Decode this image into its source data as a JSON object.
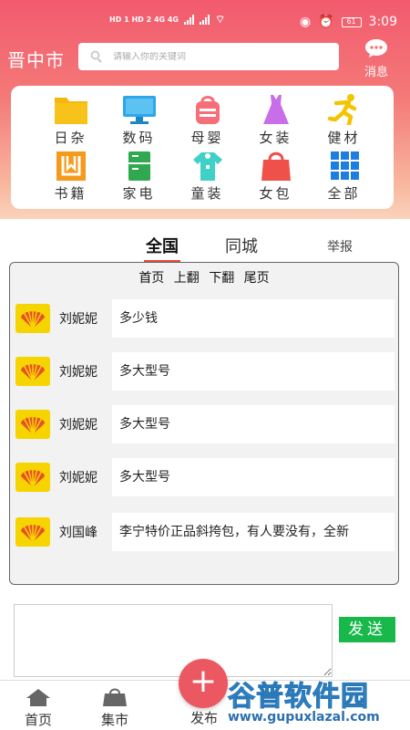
{
  "status": {
    "left": "HD 1 HD 2 4G 4G",
    "battery": "61",
    "time": "3:09"
  },
  "header": {
    "city": "晋中市",
    "search_placeholder": "请输入你的关键词",
    "message_label": "消息"
  },
  "categories": [
    {
      "label": "日杂",
      "icon": "folder-icon",
      "color": "#f7c31a"
    },
    {
      "label": "数码",
      "icon": "monitor-icon",
      "color": "#2ea7e8"
    },
    {
      "label": "母婴",
      "icon": "baby-bag-icon",
      "color": "#f56e78"
    },
    {
      "label": "女装",
      "icon": "dress-icon",
      "color": "#c76ee8"
    },
    {
      "label": "健材",
      "icon": "running-icon",
      "color": "#f5c400"
    },
    {
      "label": "书籍",
      "icon": "book-icon",
      "color": "#f59a1a"
    },
    {
      "label": "家电",
      "icon": "fridge-icon",
      "color": "#2fa84f"
    },
    {
      "label": "童装",
      "icon": "baby-clothes-icon",
      "color": "#3fd0c8"
    },
    {
      "label": "女包",
      "icon": "handbag-icon",
      "color": "#f0504a"
    },
    {
      "label": "全部",
      "icon": "grid-icon",
      "color": "#1e7de0"
    }
  ],
  "tabs": {
    "national": "全国",
    "local": "同城",
    "report": "举报"
  },
  "pager": {
    "first": "首页",
    "prev": "上翻",
    "next": "下翻",
    "last": "尾页"
  },
  "posts": [
    {
      "user": "刘妮妮",
      "text": "多少钱"
    },
    {
      "user": "刘妮妮",
      "text": "多大型号"
    },
    {
      "user": "刘妮妮",
      "text": "多大型号"
    },
    {
      "user": "刘妮妮",
      "text": "多大型号"
    },
    {
      "user": "刘国峰",
      "text": "李宁特价正品斜挎包，有人要没有，全新"
    }
  ],
  "compose": {
    "send_label": "发送"
  },
  "nav": {
    "home": "首页",
    "market": "集市",
    "publish": "发布"
  },
  "watermark": {
    "main": "谷普软件园",
    "url": "www.gupuxlazal.com"
  }
}
